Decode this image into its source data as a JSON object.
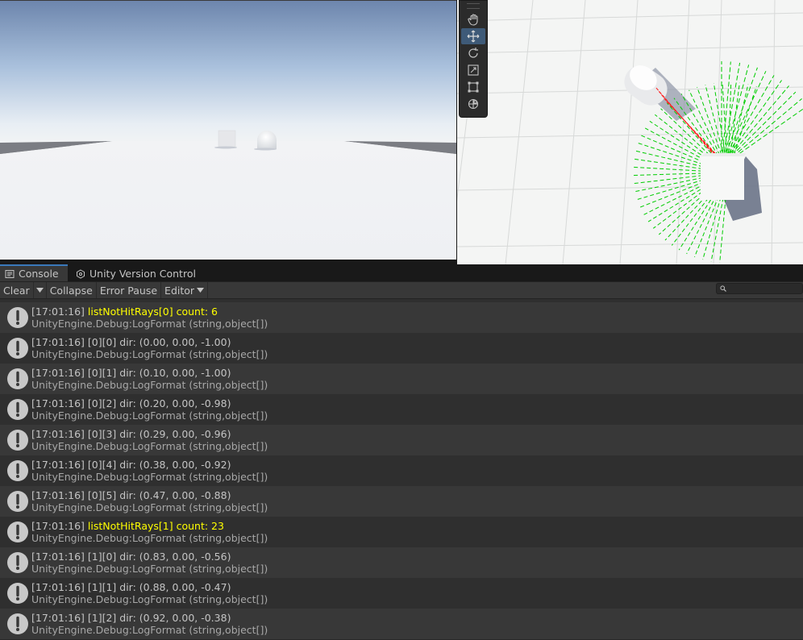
{
  "console": {
    "tabs": [
      {
        "label": "Console",
        "icon": "console-icon",
        "active": true
      },
      {
        "label": "Unity Version Control",
        "icon": "version-control-icon",
        "active": false
      }
    ],
    "toolbar": {
      "clear_label": "Clear",
      "collapse_label": "Collapse",
      "error_pause_label": "Error Pause",
      "editor_label": "Editor",
      "search_placeholder": ""
    },
    "logs": [
      {
        "timestamp": "[17:01:16]",
        "message": "listNotHitRays[0] count: 6",
        "highlight": true,
        "stack": "UnityEngine.Debug:LogFormat (string,object[])"
      },
      {
        "timestamp": "[17:01:16]",
        "message": "[0][0] dir: (0.00, 0.00, -1.00)",
        "highlight": false,
        "stack": "UnityEngine.Debug:LogFormat (string,object[])"
      },
      {
        "timestamp": "[17:01:16]",
        "message": "[0][1] dir: (0.10, 0.00, -1.00)",
        "highlight": false,
        "stack": "UnityEngine.Debug:LogFormat (string,object[])"
      },
      {
        "timestamp": "[17:01:16]",
        "message": "[0][2] dir: (0.20, 0.00, -0.98)",
        "highlight": false,
        "stack": "UnityEngine.Debug:LogFormat (string,object[])"
      },
      {
        "timestamp": "[17:01:16]",
        "message": "[0][3] dir: (0.29, 0.00, -0.96)",
        "highlight": false,
        "stack": "UnityEngine.Debug:LogFormat (string,object[])"
      },
      {
        "timestamp": "[17:01:16]",
        "message": "[0][4] dir: (0.38, 0.00, -0.92)",
        "highlight": false,
        "stack": "UnityEngine.Debug:LogFormat (string,object[])"
      },
      {
        "timestamp": "[17:01:16]",
        "message": "[0][5] dir: (0.47, 0.00, -0.88)",
        "highlight": false,
        "stack": "UnityEngine.Debug:LogFormat (string,object[])"
      },
      {
        "timestamp": "[17:01:16]",
        "message": "listNotHitRays[1] count: 23",
        "highlight": true,
        "stack": "UnityEngine.Debug:LogFormat (string,object[])"
      },
      {
        "timestamp": "[17:01:16]",
        "message": "[1][0] dir: (0.83, 0.00, -0.56)",
        "highlight": false,
        "stack": "UnityEngine.Debug:LogFormat (string,object[])"
      },
      {
        "timestamp": "[17:01:16]",
        "message": "[1][1] dir: (0.88, 0.00, -0.47)",
        "highlight": false,
        "stack": "UnityEngine.Debug:LogFormat (string,object[])"
      },
      {
        "timestamp": "[17:01:16]",
        "message": "[1][2] dir: (0.92, 0.00, -0.38)",
        "highlight": false,
        "stack": "UnityEngine.Debug:LogFormat (string,object[])"
      }
    ]
  },
  "scene_tools": [
    {
      "name": "hand-tool",
      "active": false
    },
    {
      "name": "move-tool",
      "active": true
    },
    {
      "name": "rotate-tool",
      "active": false
    },
    {
      "name": "scale-tool",
      "active": false
    },
    {
      "name": "rect-tool",
      "active": false
    },
    {
      "name": "transform-tool",
      "active": false
    }
  ],
  "colors": {
    "highlight_text": "#ffff00",
    "ray_hit": "#ff2020",
    "ray_miss": "#00cc00",
    "active_tab_accent": "#3a79bb"
  }
}
